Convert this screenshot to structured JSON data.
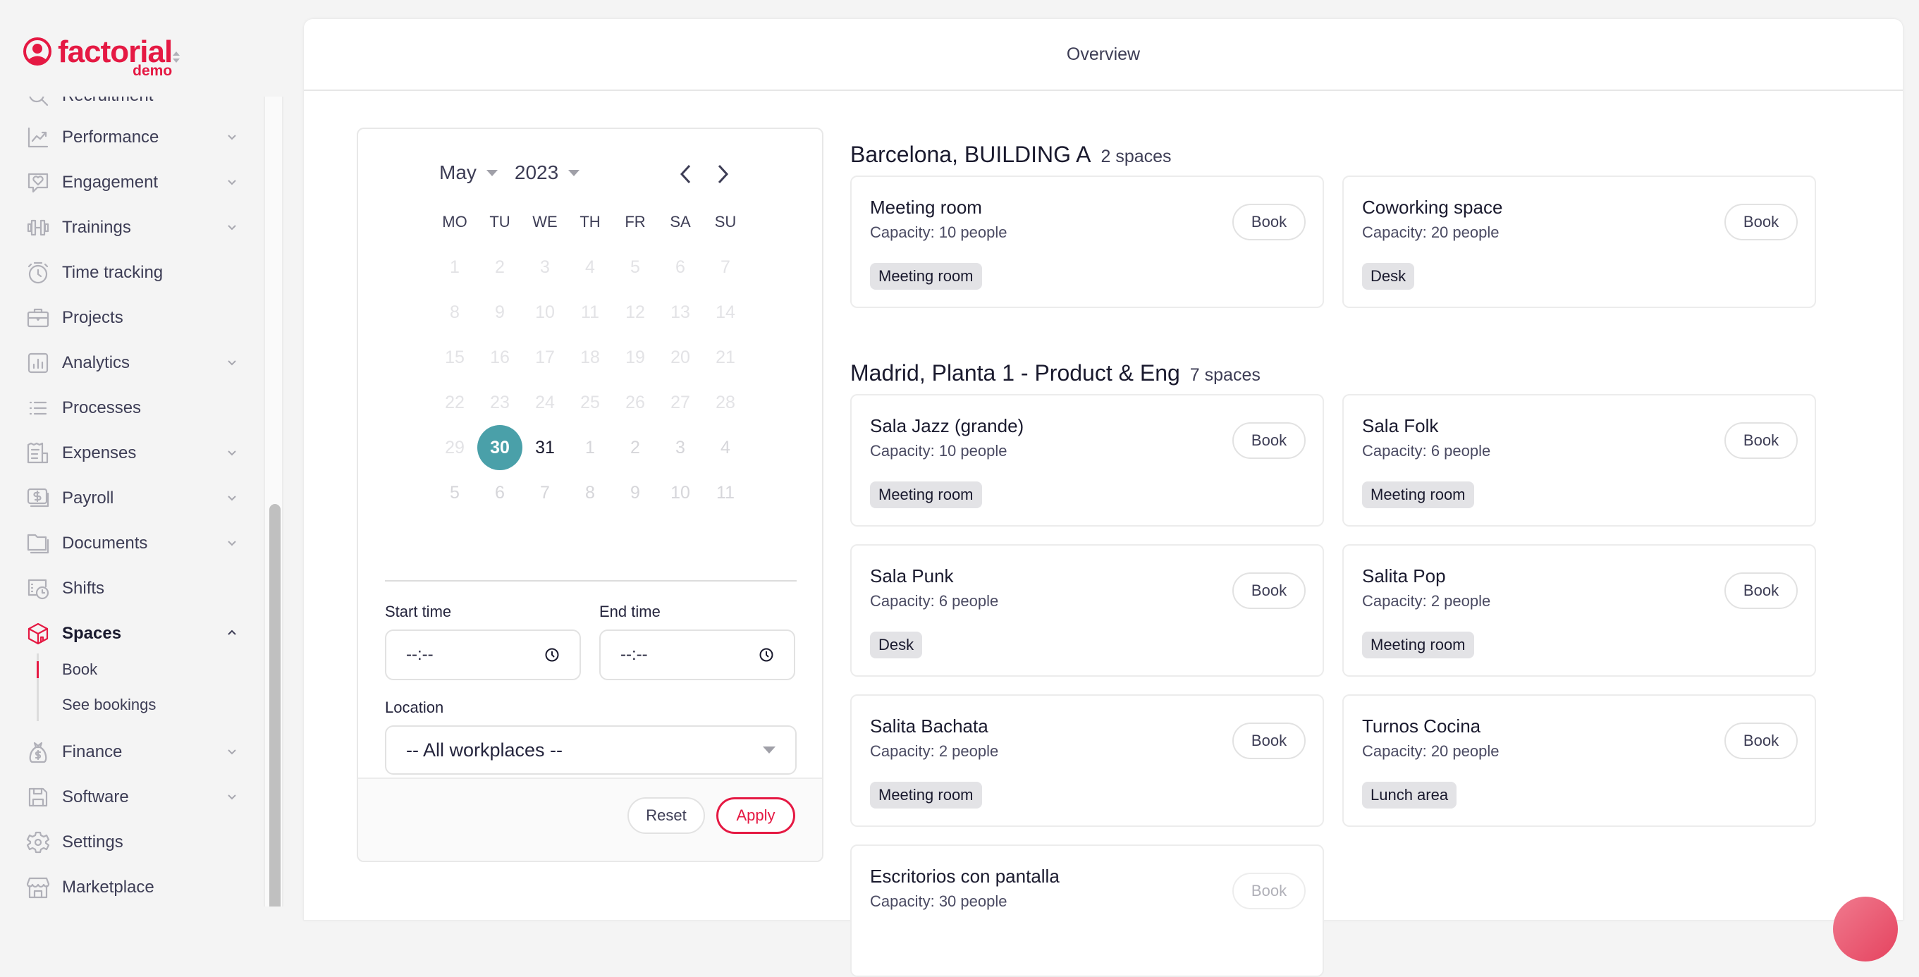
{
  "brand": {
    "name": "factorial",
    "sub": "demo",
    "color": "#e51943"
  },
  "sidebar": {
    "items": [
      {
        "label": "Recruitment",
        "icon": "search-icon",
        "chevron": false
      },
      {
        "label": "Performance",
        "icon": "chart-line-icon",
        "chevron": true
      },
      {
        "label": "Engagement",
        "icon": "heart-chat-icon",
        "chevron": true
      },
      {
        "label": "Trainings",
        "icon": "dumbbell-icon",
        "chevron": true
      },
      {
        "label": "Time tracking",
        "icon": "stopwatch-icon",
        "chevron": false
      },
      {
        "label": "Projects",
        "icon": "briefcase-icon",
        "chevron": false
      },
      {
        "label": "Analytics",
        "icon": "bar-chart-icon",
        "chevron": true
      },
      {
        "label": "Processes",
        "icon": "list-icon",
        "chevron": false
      },
      {
        "label": "Expenses",
        "icon": "receipt-icon",
        "chevron": true
      },
      {
        "label": "Payroll",
        "icon": "money-icon",
        "chevron": true
      },
      {
        "label": "Documents",
        "icon": "folder-icon",
        "chevron": true
      },
      {
        "label": "Shifts",
        "icon": "schedule-clock-icon",
        "chevron": false
      },
      {
        "label": "Spaces",
        "icon": "cube-icon",
        "chevron": "up",
        "active": true
      },
      {
        "label": "Finance",
        "icon": "money-bag-icon",
        "chevron": true
      },
      {
        "label": "Software",
        "icon": "floppy-icon",
        "chevron": true
      },
      {
        "label": "Settings",
        "icon": "gear-icon",
        "chevron": false
      },
      {
        "label": "Marketplace",
        "icon": "store-icon",
        "chevron": false
      }
    ],
    "spaces_sub": [
      {
        "label": "Book",
        "active": true
      },
      {
        "label": "See bookings",
        "active": false
      }
    ]
  },
  "header": {
    "title": "Overview"
  },
  "filter": {
    "month": "May",
    "year": "2023",
    "weekdays": [
      "MO",
      "TU",
      "WE",
      "TH",
      "FR",
      "SA",
      "SU"
    ],
    "weeks": [
      [
        "1",
        "2",
        "3",
        "4",
        "5",
        "6",
        "7"
      ],
      [
        "8",
        "9",
        "10",
        "11",
        "12",
        "13",
        "14"
      ],
      [
        "15",
        "16",
        "17",
        "18",
        "19",
        "20",
        "21"
      ],
      [
        "22",
        "23",
        "24",
        "25",
        "26",
        "27",
        "28"
      ],
      [
        "29",
        "30",
        "31",
        "1",
        "2",
        "3",
        "4"
      ],
      [
        "5",
        "6",
        "7",
        "8",
        "9",
        "10",
        "11"
      ]
    ],
    "selected_day": "30",
    "available_days": [
      "31"
    ],
    "start_time_label": "Start time",
    "start_time_value": "--:--",
    "end_time_label": "End time",
    "end_time_value": "--:--",
    "location_label": "Location",
    "location_value": "-- All workplaces --",
    "reset_label": "Reset",
    "apply_label": "Apply",
    "selected_color": "#4aa0a9"
  },
  "groups": [
    {
      "title": "Barcelona, BUILDING A",
      "count": "2 spaces",
      "spaces": [
        {
          "name": "Meeting room",
          "capacity": "Capacity: 10 people",
          "tag": "Meeting room",
          "book": "Book",
          "disabled": false
        },
        {
          "name": "Coworking space",
          "capacity": "Capacity: 20 people",
          "tag": "Desk",
          "book": "Book",
          "disabled": false
        }
      ]
    },
    {
      "title": "Madrid, Planta 1 - Product & Eng",
      "count": "7 spaces",
      "spaces": [
        {
          "name": "Sala Jazz (grande)",
          "capacity": "Capacity: 10 people",
          "tag": "Meeting room",
          "book": "Book",
          "disabled": false
        },
        {
          "name": "Sala Folk",
          "capacity": "Capacity: 6 people",
          "tag": "Meeting room",
          "book": "Book",
          "disabled": false
        },
        {
          "name": "Sala Punk",
          "capacity": "Capacity: 6 people",
          "tag": "Desk",
          "book": "Book",
          "disabled": false
        },
        {
          "name": "Salita Pop",
          "capacity": "Capacity: 2 people",
          "tag": "Meeting room",
          "book": "Book",
          "disabled": false
        },
        {
          "name": "Salita Bachata",
          "capacity": "Capacity: 2 people",
          "tag": "Meeting room",
          "book": "Book",
          "disabled": false
        },
        {
          "name": "Turnos Cocina",
          "capacity": "Capacity: 20 people",
          "tag": "Lunch area",
          "book": "Book",
          "disabled": false
        },
        {
          "name": "Escritorios con pantalla",
          "capacity": "Capacity: 30 people",
          "tag": "",
          "book": "Book",
          "disabled": true
        }
      ]
    }
  ]
}
